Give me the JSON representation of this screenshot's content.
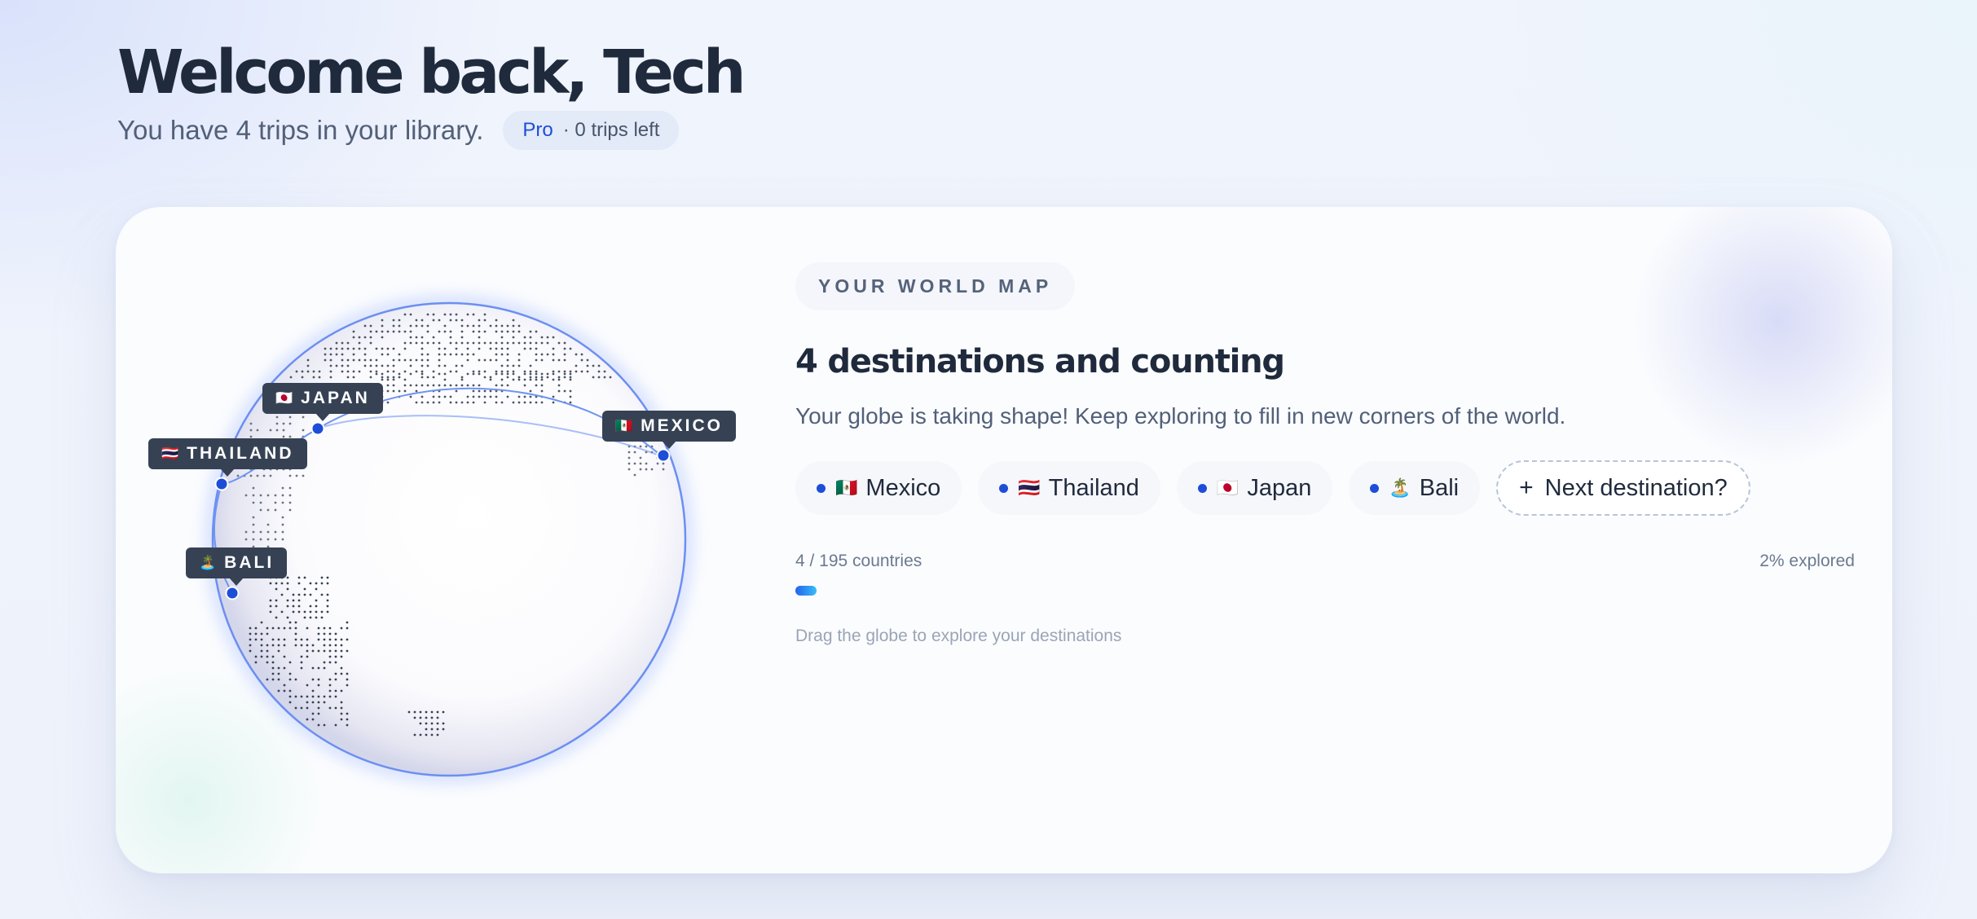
{
  "header": {
    "title": "Welcome back, Tech",
    "subtitle": "You have 4 trips in your library.",
    "plan": {
      "name": "Pro",
      "remaining": "· 0 trips left"
    }
  },
  "map_card": {
    "section_label": "YOUR WORLD MAP",
    "headline": "4 destinations and counting",
    "description": "Your globe is taking shape! Keep exploring to fill in new corners of the world.",
    "destinations": [
      {
        "name": "Mexico",
        "flag": "🇲🇽",
        "label": "MEXICO"
      },
      {
        "name": "Thailand",
        "flag": "🇹🇭",
        "label": "THAILAND"
      },
      {
        "name": "Japan",
        "flag": "🇯🇵",
        "label": "JAPAN"
      },
      {
        "name": "Bali",
        "flag": "🏝️",
        "label": "BALI"
      }
    ],
    "add_label": "Next destination?",
    "progress": {
      "count_text": "4 / 195 countries",
      "percent_text": "2% explored",
      "fraction": 0.02
    },
    "hint": "Drag the globe to explore your destinations"
  },
  "colors": {
    "accent": "#1d4ed8",
    "marker_label_bg": "#364254",
    "globe_outline": "#6c8ff0"
  },
  "icons": {
    "add": "plus-icon",
    "dot": "destination-dot-icon"
  }
}
